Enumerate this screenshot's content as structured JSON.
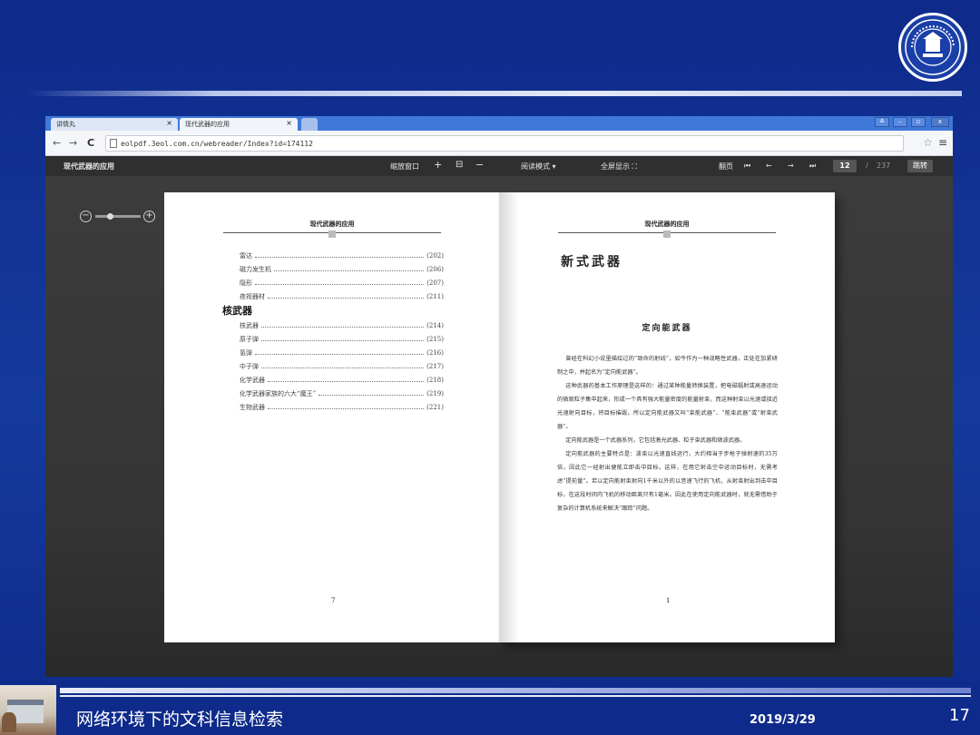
{
  "slide": {
    "footer_title": "网络环境下的文科信息检索",
    "date": "2019/3/29",
    "slide_number": "17"
  },
  "browser": {
    "tabs": [
      {
        "label": "讲情丸"
      },
      {
        "label": "现代武器的应用"
      }
    ],
    "url": "eolpdf.3eol.com.cn/webreader/Index?id=174112"
  },
  "reader_toolbar": {
    "book_title": "现代武器的应用",
    "zoom_label": "缩放窗口",
    "read_mode_label": "阅读模式",
    "fullscreen_label": "全屏显示",
    "page_turn_label": "翻页",
    "current_page": "12",
    "page_separator": "/",
    "total_pages": "237",
    "jump_label": "跳转"
  },
  "left_page": {
    "header": "现代武器的应用",
    "toc_items_top": [
      {
        "label": "雷达",
        "page": "(202)"
      },
      {
        "label": "磁力发生机",
        "page": "(206)"
      },
      {
        "label": "隐形",
        "page": "(207)"
      },
      {
        "label": "夜视器材",
        "page": "(211)"
      }
    ],
    "section_heading": "核武器",
    "toc_items_section": [
      {
        "label": "核武器",
        "page": "(214)"
      },
      {
        "label": "原子弹",
        "page": "(215)"
      },
      {
        "label": "氢弹",
        "page": "(216)"
      },
      {
        "label": "中子弹",
        "page": "(217)"
      },
      {
        "label": "化学武器",
        "page": "(218)"
      },
      {
        "label": "化学武器家族的六大“魔王”",
        "page": "(219)"
      },
      {
        "label": "生物武器",
        "page": "(221)"
      }
    ],
    "page_number": "7"
  },
  "right_page": {
    "header": "现代武器的应用",
    "chapter_title": "新式武器",
    "section_title": "定向能武器",
    "paragraphs": [
      "曾经在科幻小说里描绘过的“致命的射线”，如今作为一种战略性武器，正处在加紧研制之中，并起名为“定向能武器”。",
      "这种武器的基本工作原理是这样的：通过某种能量转换装置，把电磁辐射或高速运动的微观粒子集中起来，形成一个具有强大能量密度的能量射束，而这种射束以光速或接近光速射向目标，将目标摧毁。所以定向能武器又叫“束能武器”、“能束武器”或“射束武器”。",
      "定向能武器是一个武器系列，它包括激光武器、粒子束武器和微波武器。",
      "定向能武器的主要特点是：波束以光速直线运行，大约相当于步枪子弹射速的35万倍，因此它一经射出便能立即击中目标。这样，在用它射击空中运动目标时，无需考虑“提前量”。若以定向能射束射向1千米以外的以音速飞行的飞机，从射束射出到击中目标，在这段时间内飞机的移动距离只有1毫米。因此在使用定向能武器时，就无需借助于复杂的计算机系统来解决“跟踪”问题。"
    ],
    "page_number": "1"
  }
}
